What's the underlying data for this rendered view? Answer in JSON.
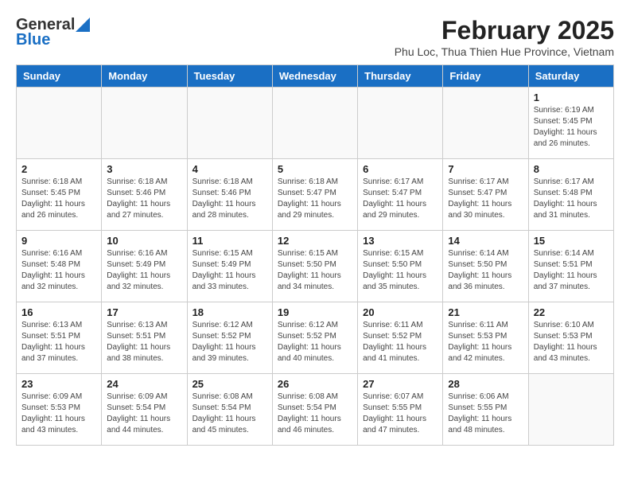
{
  "header": {
    "logo_general": "General",
    "logo_blue": "Blue",
    "title": "February 2025",
    "subtitle": "Phu Loc, Thua Thien Hue Province, Vietnam"
  },
  "days_of_week": [
    "Sunday",
    "Monday",
    "Tuesday",
    "Wednesday",
    "Thursday",
    "Friday",
    "Saturday"
  ],
  "weeks": [
    [
      {
        "day": "",
        "info": ""
      },
      {
        "day": "",
        "info": ""
      },
      {
        "day": "",
        "info": ""
      },
      {
        "day": "",
        "info": ""
      },
      {
        "day": "",
        "info": ""
      },
      {
        "day": "",
        "info": ""
      },
      {
        "day": "1",
        "info": "Sunrise: 6:19 AM\nSunset: 5:45 PM\nDaylight: 11 hours and 26 minutes."
      }
    ],
    [
      {
        "day": "2",
        "info": "Sunrise: 6:18 AM\nSunset: 5:45 PM\nDaylight: 11 hours and 26 minutes."
      },
      {
        "day": "3",
        "info": "Sunrise: 6:18 AM\nSunset: 5:46 PM\nDaylight: 11 hours and 27 minutes."
      },
      {
        "day": "4",
        "info": "Sunrise: 6:18 AM\nSunset: 5:46 PM\nDaylight: 11 hours and 28 minutes."
      },
      {
        "day": "5",
        "info": "Sunrise: 6:18 AM\nSunset: 5:47 PM\nDaylight: 11 hours and 29 minutes."
      },
      {
        "day": "6",
        "info": "Sunrise: 6:17 AM\nSunset: 5:47 PM\nDaylight: 11 hours and 29 minutes."
      },
      {
        "day": "7",
        "info": "Sunrise: 6:17 AM\nSunset: 5:47 PM\nDaylight: 11 hours and 30 minutes."
      },
      {
        "day": "8",
        "info": "Sunrise: 6:17 AM\nSunset: 5:48 PM\nDaylight: 11 hours and 31 minutes."
      }
    ],
    [
      {
        "day": "9",
        "info": "Sunrise: 6:16 AM\nSunset: 5:48 PM\nDaylight: 11 hours and 32 minutes."
      },
      {
        "day": "10",
        "info": "Sunrise: 6:16 AM\nSunset: 5:49 PM\nDaylight: 11 hours and 32 minutes."
      },
      {
        "day": "11",
        "info": "Sunrise: 6:15 AM\nSunset: 5:49 PM\nDaylight: 11 hours and 33 minutes."
      },
      {
        "day": "12",
        "info": "Sunrise: 6:15 AM\nSunset: 5:50 PM\nDaylight: 11 hours and 34 minutes."
      },
      {
        "day": "13",
        "info": "Sunrise: 6:15 AM\nSunset: 5:50 PM\nDaylight: 11 hours and 35 minutes."
      },
      {
        "day": "14",
        "info": "Sunrise: 6:14 AM\nSunset: 5:50 PM\nDaylight: 11 hours and 36 minutes."
      },
      {
        "day": "15",
        "info": "Sunrise: 6:14 AM\nSunset: 5:51 PM\nDaylight: 11 hours and 37 minutes."
      }
    ],
    [
      {
        "day": "16",
        "info": "Sunrise: 6:13 AM\nSunset: 5:51 PM\nDaylight: 11 hours and 37 minutes."
      },
      {
        "day": "17",
        "info": "Sunrise: 6:13 AM\nSunset: 5:51 PM\nDaylight: 11 hours and 38 minutes."
      },
      {
        "day": "18",
        "info": "Sunrise: 6:12 AM\nSunset: 5:52 PM\nDaylight: 11 hours and 39 minutes."
      },
      {
        "day": "19",
        "info": "Sunrise: 6:12 AM\nSunset: 5:52 PM\nDaylight: 11 hours and 40 minutes."
      },
      {
        "day": "20",
        "info": "Sunrise: 6:11 AM\nSunset: 5:52 PM\nDaylight: 11 hours and 41 minutes."
      },
      {
        "day": "21",
        "info": "Sunrise: 6:11 AM\nSunset: 5:53 PM\nDaylight: 11 hours and 42 minutes."
      },
      {
        "day": "22",
        "info": "Sunrise: 6:10 AM\nSunset: 5:53 PM\nDaylight: 11 hours and 43 minutes."
      }
    ],
    [
      {
        "day": "23",
        "info": "Sunrise: 6:09 AM\nSunset: 5:53 PM\nDaylight: 11 hours and 43 minutes."
      },
      {
        "day": "24",
        "info": "Sunrise: 6:09 AM\nSunset: 5:54 PM\nDaylight: 11 hours and 44 minutes."
      },
      {
        "day": "25",
        "info": "Sunrise: 6:08 AM\nSunset: 5:54 PM\nDaylight: 11 hours and 45 minutes."
      },
      {
        "day": "26",
        "info": "Sunrise: 6:08 AM\nSunset: 5:54 PM\nDaylight: 11 hours and 46 minutes."
      },
      {
        "day": "27",
        "info": "Sunrise: 6:07 AM\nSunset: 5:55 PM\nDaylight: 11 hours and 47 minutes."
      },
      {
        "day": "28",
        "info": "Sunrise: 6:06 AM\nSunset: 5:55 PM\nDaylight: 11 hours and 48 minutes."
      },
      {
        "day": "",
        "info": ""
      }
    ]
  ]
}
